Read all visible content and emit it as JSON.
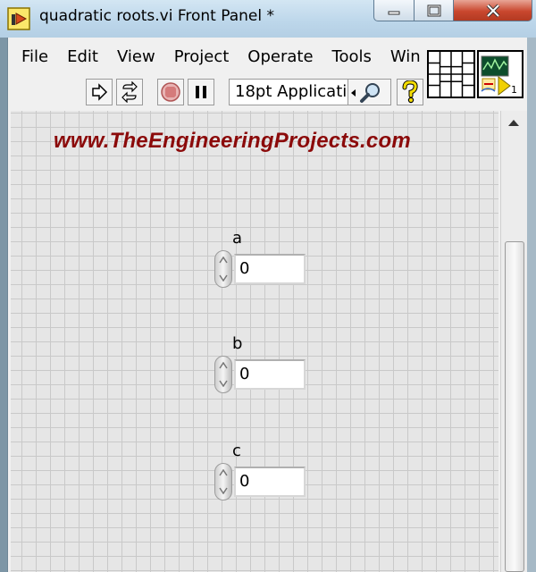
{
  "window": {
    "title": "quadratic roots.vi Front Panel *",
    "controls": [
      "minimize",
      "maximize",
      "close"
    ]
  },
  "menu": {
    "items": [
      "File",
      "Edit",
      "View",
      "Project",
      "Operate",
      "Tools",
      "Win"
    ]
  },
  "toolbar": {
    "font_selector_value": "18pt Applicati",
    "icons": [
      "run-arrow-icon",
      "run-continuously-icon",
      "abort-execution-icon",
      "pause-icon",
      "search-icon",
      "help-icon"
    ]
  },
  "connector": {
    "terminal_number": "1"
  },
  "panel": {
    "watermark": "www.TheEngineeringProjects.com",
    "controls": [
      {
        "label": "a",
        "value": "0"
      },
      {
        "label": "b",
        "value": "0"
      },
      {
        "label": "c",
        "value": "0"
      }
    ]
  },
  "colors": {
    "watermark": "#8b0a0a",
    "titlebar": "#bcd6ea",
    "panel_background": "#e6e6e6",
    "grid": "#c9c9c9",
    "close_button": "#c9472e"
  }
}
